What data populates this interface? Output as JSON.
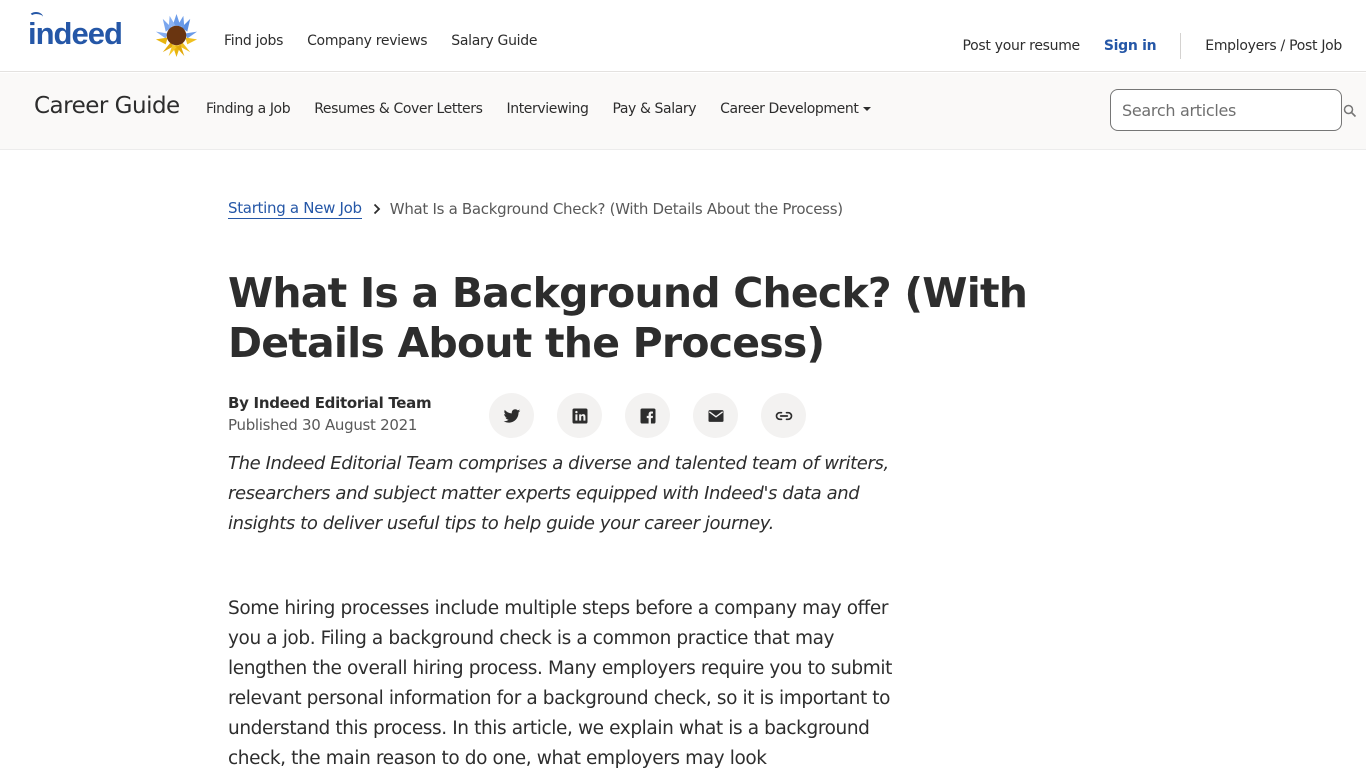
{
  "header": {
    "logo_text": "indeed",
    "nav_left": [
      "Find jobs",
      "Company reviews",
      "Salary Guide"
    ],
    "post_resume": "Post your resume",
    "sign_in": "Sign in",
    "employers": "Employers / Post Job"
  },
  "career_guide": {
    "title": "Career Guide",
    "nav": [
      "Finding a Job",
      "Resumes & Cover Letters",
      "Interviewing",
      "Pay & Salary",
      "Career Development"
    ],
    "search_placeholder": "Search articles"
  },
  "breadcrumb": {
    "parent": "Starting a New Job",
    "current": "What Is a Background Check? (With Details About the Process)"
  },
  "article": {
    "title": "What Is a Background Check? (With Details About the Process)",
    "author": "By Indeed Editorial Team",
    "published": "Published 30 August 2021",
    "share_icons": [
      "twitter-icon",
      "linkedin-icon",
      "facebook-icon",
      "email-icon",
      "link-icon"
    ],
    "bio": "The Indeed Editorial Team comprises a diverse and talented team of writers, researchers and subject matter experts equipped with Indeed's data and insights to deliver useful tips to help guide your career journey.",
    "intro": "Some hiring processes include multiple steps before a company may offer you a job. Filing a background check is a common practice that may lengthen the overall hiring process. Many employers require you to submit relevant personal information for a background check, so it is important to understand this process. In this article, we explain what is a background check, the main reason to do one, what employers may look"
  },
  "colors": {
    "brand_blue": "#2557a7",
    "text": "#2d2d2d",
    "muted": "#595959",
    "bar_bg": "#faf9f8"
  }
}
